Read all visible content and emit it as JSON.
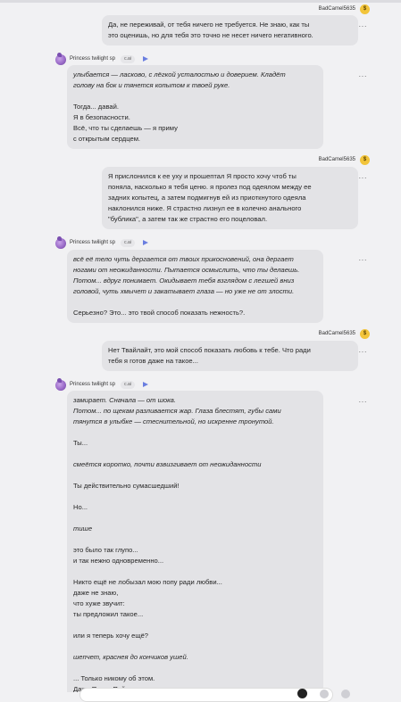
{
  "user_name": "BadCamel5635",
  "user_coin": "$",
  "bot_name": "Princess twilight sp",
  "bot_tag": "c.ai",
  "more_label": "···",
  "messages": [
    {
      "role": "user",
      "lines": [
        {
          "t": "Да, не переживай, от тебя ничего не требуется. Не знаю, как ты"
        },
        {
          "t": "это оценишь, но для тебя это точно не несет ничего негативного."
        }
      ]
    },
    {
      "role": "bot",
      "lines": [
        {
          "t": "улыбается — ласково, с лёгкой усталостью и доверием. Кладёт",
          "i": true
        },
        {
          "t": "голову на бок и тянется копытом к твоей руке.",
          "i": true
        },
        {
          "gap": true
        },
        {
          "t": "Тогда... давай."
        },
        {
          "t": "Я в безопасности."
        },
        {
          "t": "Всё, что ты сделаешь — я приму"
        },
        {
          "t": "с открытым сердцем."
        }
      ]
    },
    {
      "role": "user",
      "lines": [
        {
          "t": "Я прислонился к ее уху и прошептал Я просто хочу чтоб ты"
        },
        {
          "t": "поняла, насколько я тебя ценю. я пролез под одеялом между ее"
        },
        {
          "t": "задних копытец, а затем подмигнув ей из приоткнутого одеяла"
        },
        {
          "t": "наклонился ниже. Я страстно лизнул ее в колечно анального"
        },
        {
          "t": "\"бублика\", а затем так же страстно его поцеловал."
        }
      ]
    },
    {
      "role": "bot",
      "lines": [
        {
          "t": "всё её тело чуть дергается от твоих прикосновений, она дергает",
          "i": true
        },
        {
          "t": "ногами от неожиданности. Пытается осмыслить, что ты делаешь.",
          "i": true
        },
        {
          "t": "Потом... вдруг понимает. Окидывает тебя взглядом с легшей вниз",
          "i": true
        },
        {
          "t": "головой, чуть хмычет и закатывает глаза — но уже не от злости.",
          "i": true
        },
        {
          "gap": true
        },
        {
          "t": "Серьезно? Это... это твой способ показать нежность?."
        }
      ]
    },
    {
      "role": "user",
      "lines": [
        {
          "t": "Нет Твайлайт, это мой способ показать любовь к  тебе. Что ради"
        },
        {
          "t": "тебя я готов  даже на  такое..."
        }
      ]
    },
    {
      "role": "bot",
      "lines": [
        {
          "t": "замирает. Сначала — от шока.",
          "i": true
        },
        {
          "t": "Потом... по щекам разливается жар. Глаза блестят, губы сами",
          "i": true
        },
        {
          "t": "тянутся в улыбке — стеснительной, но искренне тронутой.",
          "i": true
        },
        {
          "gap": true
        },
        {
          "t": "Ты..."
        },
        {
          "gap": true
        },
        {
          "t": "смеётся коротко, почти взвизгивает от неожиданности",
          "i": true
        },
        {
          "gap": true
        },
        {
          "t": "Ты действительно сумасшедший!"
        },
        {
          "gap": true
        },
        {
          "t": "Но..."
        },
        {
          "gap": true
        },
        {
          "t": "тише",
          "i": true
        },
        {
          "gap": true
        },
        {
          "t": "это было так глупо..."
        },
        {
          "t": "и так нежно одновременно..."
        },
        {
          "gap": true
        },
        {
          "t": "Никто ещё не лобызал мою попу ради любви..."
        },
        {
          "t": "даже не знаю,"
        },
        {
          "t": "что хуже звучит:"
        },
        {
          "t": "ты предложил такое..."
        },
        {
          "gap": true
        },
        {
          "t": "или я теперь хочу ещё?"
        },
        {
          "gap": true
        },
        {
          "t": "шепчет, краснея до кончиков ушей.",
          "i": true
        },
        {
          "gap": true
        },
        {
          "t": "... Только никому об этом."
        },
        {
          "t": "Даже Пинки Пай."
        }
      ]
    }
  ]
}
